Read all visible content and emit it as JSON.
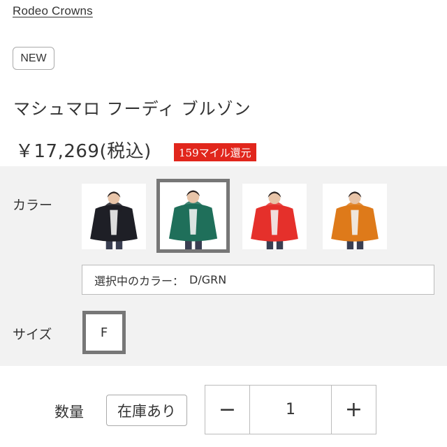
{
  "brand": {
    "name": "Rodeo Crowns"
  },
  "badge": {
    "new_label": "NEW"
  },
  "product": {
    "title": "マシュマロ フーディ ブルゾン",
    "price": "￥17,269(税込)",
    "mile_label": "159マイル還元"
  },
  "options": {
    "color_label": "カラー",
    "swatches": [
      {
        "name": "black",
        "color": "#1e1f26",
        "selected": false
      },
      {
        "name": "D/GRN",
        "color": "#1f6f5a",
        "selected": true
      },
      {
        "name": "red",
        "color": "#e5302b",
        "selected": false
      },
      {
        "name": "orange",
        "color": "#de7a1a",
        "selected": false
      }
    ],
    "selected_color_label": "選択中のカラー：",
    "selected_color_value": "D/GRN",
    "size_label": "サイズ",
    "size_value": "F"
  },
  "quantity": {
    "label": "数量",
    "stock_label": "在庫あり",
    "minus_symbol": "−",
    "value": "1",
    "plus_symbol": "+"
  }
}
